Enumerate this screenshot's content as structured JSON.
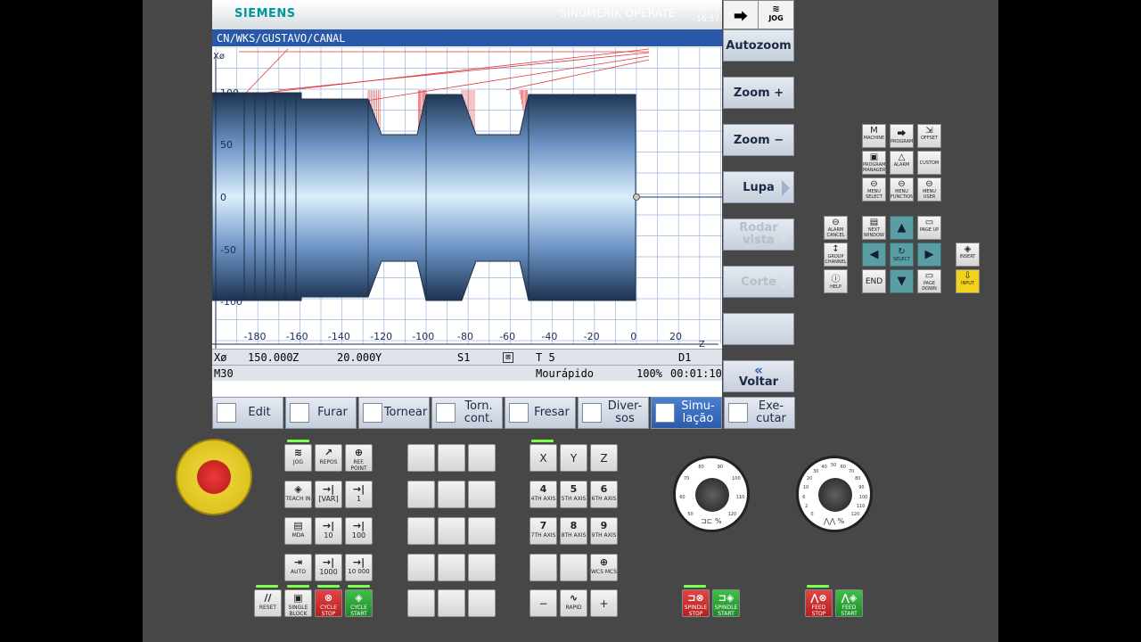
{
  "header": {
    "brand": "SIEMENS",
    "product": "SINUMERIK OPERATE",
    "date": "03.10.21",
    "time": "16:57",
    "mode": "JOG"
  },
  "path": "CN/WKS/GUSTAVO/CANAL",
  "plot": {
    "x_label": "Xø",
    "z_label": "Z",
    "z_ticks": [
      "-180",
      "-160",
      "-140",
      "-120",
      "-100",
      "-80",
      "-60",
      "-40",
      "-20",
      "0",
      "20"
    ],
    "x_ticks": [
      "100",
      "50",
      "0",
      "-50",
      "-100"
    ]
  },
  "status": {
    "x_label": "Xø",
    "x_value": "150.000",
    "z_label": "Z",
    "z_value": "20.000",
    "y_label": "Y",
    "spindle": "S1",
    "tool": "T 5",
    "d": "D1",
    "block": "M30",
    "feed_mode": "Mourápido",
    "override": "100%",
    "elapsed": "00:01:10"
  },
  "vertical_softkeys": [
    "Autozoom",
    "Zoom +",
    "Zoom −",
    "Lupa",
    "Rodar vista",
    "Corte",
    "",
    "Voltar"
  ],
  "horizontal_softkeys": [
    "Edit",
    "Furar",
    "Tornear",
    "Torn. cont.",
    "Fresar",
    "Diver-sos",
    "Simu-lação",
    "Exe-cutar"
  ],
  "nav_keys": {
    "machine": "MACHINE",
    "machine_glyph": "M",
    "program": "PROGRAM",
    "offset": "OFFSET",
    "prog_manager": "PROGRAM MANAGER",
    "alarm": "ALARM",
    "custom": "CUSTOM",
    "menu_select": "MENU SELECT",
    "menu_function": "MENU FUNCTION",
    "menu_user": "MENU USER",
    "alarm_cancel": "ALARM CANCEL",
    "next_window": "NEXT WINDOW",
    "page_up": "PAGE UP",
    "insert": "INSERT",
    "group_channel": "GROUP CHANNEL",
    "select": "SELECT",
    "help": "HELP",
    "end": "END",
    "page_down": "PAGE DOWN",
    "input": "INPUT"
  },
  "machine_keys": {
    "jog": "JOG",
    "repos": "REPOS",
    "ref_point": "REF. POINT",
    "teach_in": "TEACH IN",
    "var": "[VAR]",
    "one": "1",
    "mda": "MDA",
    "ten": "10",
    "hundred": "100",
    "auto": "AUTO",
    "thousand": "1000",
    "ten_thousand": "10 000",
    "reset": "RESET",
    "single_block": "SINGLE BLOCK",
    "cycle_stop": "CYCLE STOP",
    "cycle_start": "CYCLE START"
  },
  "axis_keys": {
    "x": "X",
    "y": "Y",
    "z": "Z",
    "a4": "4",
    "a4l": "4TH AXIS",
    "a5": "5",
    "a5l": "5TH AXIS",
    "a6": "6",
    "a6l": "6TH AXIS",
    "a7": "7",
    "a7l": "7TH AXIS",
    "a8": "8",
    "a8l": "8TH AXIS",
    "a9": "9",
    "a9l": "9TH AXIS",
    "wcs": "WCS MCS",
    "minus": "−",
    "rapid": "RAPID",
    "plus": "+"
  },
  "knobs": {
    "spindle_ticks": [
      "50",
      "60",
      "70",
      "80",
      "90",
      "100",
      "110",
      "120"
    ],
    "feed_ticks": [
      "0",
      "2",
      "6",
      "10",
      "20",
      "30",
      "40",
      "50",
      "60",
      "70",
      "80",
      "90",
      "100",
      "110",
      "120"
    ],
    "spindle_label": "%",
    "feed_label": "%"
  },
  "spindle_keys": {
    "stop": "SPINDLE STOP",
    "start": "SPINDLE START"
  },
  "feed_keys": {
    "stop": "FEED STOP",
    "start": "FEED START"
  }
}
